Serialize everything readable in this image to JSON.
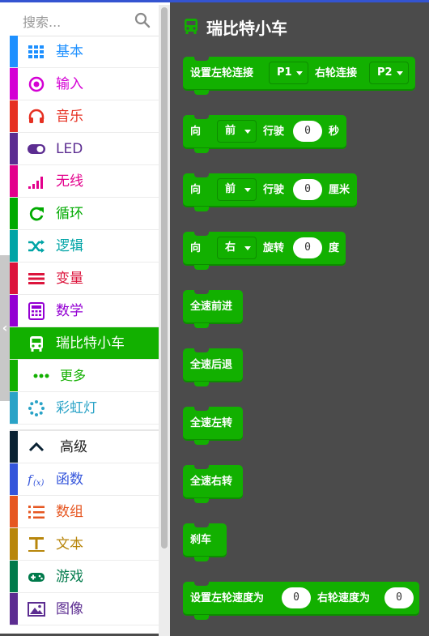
{
  "search": {
    "placeholder": "搜索..."
  },
  "categories": [
    {
      "label": "基本",
      "color": "#1e90ff",
      "icon": "grid-icon"
    },
    {
      "label": "输入",
      "color": "#d400d4",
      "icon": "target-icon"
    },
    {
      "label": "音乐",
      "color": "#e63022",
      "icon": "headphones-icon"
    },
    {
      "label": "LED",
      "color": "#5c2d91",
      "icon": "toggle-icon"
    },
    {
      "label": "无线",
      "color": "#e3008c",
      "icon": "signal-bars-icon"
    },
    {
      "label": "循环",
      "color": "#00aa00",
      "icon": "loop-icon"
    },
    {
      "label": "逻辑",
      "color": "#00a4a6",
      "icon": "shuffle-icon"
    },
    {
      "label": "变量",
      "color": "#dc143c",
      "icon": "list-lines-icon"
    },
    {
      "label": "数学",
      "color": "#9400d3",
      "icon": "calculator-icon"
    },
    {
      "label": "瑞比特小车",
      "color": "#12b000",
      "icon": "bus-icon"
    },
    {
      "label": "更多",
      "color": "#12b000",
      "icon": "more-dots-icon"
    },
    {
      "label": "彩虹灯",
      "color": "#2aa3c7",
      "icon": "dotted-circle-icon"
    }
  ],
  "advanced": {
    "label": "高级",
    "color": "#0a2233"
  },
  "advanced_categories": [
    {
      "label": "函数",
      "color": "#3455db",
      "icon": "function-icon"
    },
    {
      "label": "数组",
      "color": "#e65722",
      "icon": "numbered-list-icon"
    },
    {
      "label": "文本",
      "color": "#b8860b",
      "icon": "text-icon"
    },
    {
      "label": "游戏",
      "color": "#007a4b",
      "icon": "gamepad-icon"
    },
    {
      "label": "图像",
      "color": "#5c2d91",
      "icon": "image-icon"
    }
  ],
  "flyout": {
    "title": "瑞比特小车",
    "blocks": [
      {
        "parts": [
          "设置左轮连接",
          "P1",
          "右轮连接",
          "P2"
        ]
      },
      {
        "parts": [
          "向",
          "前",
          "行驶",
          "0",
          "秒"
        ]
      },
      {
        "parts": [
          "向",
          "前",
          "行驶",
          "0",
          "厘米"
        ]
      },
      {
        "parts": [
          "向",
          "右",
          "旋转",
          "0",
          "度"
        ]
      },
      {
        "parts": [
          "全速前进"
        ]
      },
      {
        "parts": [
          "全速后退"
        ]
      },
      {
        "parts": [
          "全速左转"
        ]
      },
      {
        "parts": [
          "全速右转"
        ]
      },
      {
        "parts": [
          "刹车"
        ]
      },
      {
        "parts": [
          "设置左轮速度为",
          "0",
          "右轮速度为",
          "0"
        ]
      }
    ]
  },
  "colors": {
    "accent": "#12b000",
    "workspace": "#4b4b4b"
  }
}
